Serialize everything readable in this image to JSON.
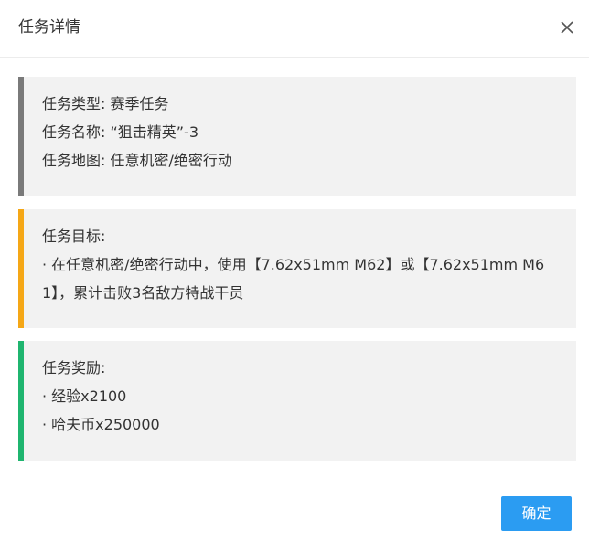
{
  "dialog": {
    "title": "任务详情",
    "close_icon": "close-icon"
  },
  "info": {
    "type_line": "任务类型: 赛季任务",
    "name_line": "任务名称: “狙击精英”-3",
    "map_line": "任务地图: 任意机密/绝密行动"
  },
  "objective": {
    "heading": "任务目标:",
    "text": "· 在任意机密/绝密行动中，使用【7.62x51mm M62】或【7.62x51mm M61】，累计击败3名敌方特战干员"
  },
  "reward": {
    "heading": "任务奖励:",
    "items": [
      "· 经验x2100",
      "· 哈夫币x250000"
    ]
  },
  "footer": {
    "confirm_label": "确定"
  },
  "colors": {
    "info_bar": "#7a7a7a",
    "objective_bar": "#f5a716",
    "reward_bar": "#1fb56f",
    "confirm_bg": "#2b9cf2"
  }
}
